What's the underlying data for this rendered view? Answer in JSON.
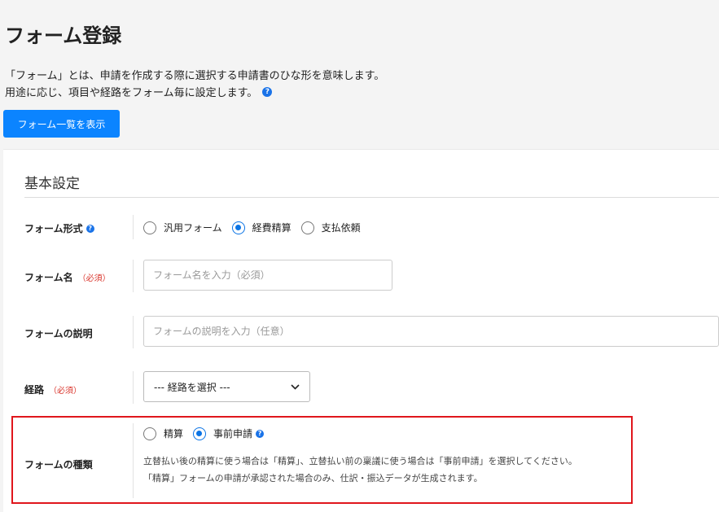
{
  "header": {
    "title": "フォーム登録",
    "desc_line1": "「フォーム」とは、申請を作成する際に選択する申請書のひな形を意味します。",
    "desc_line2": "用途に応じ、項目や経路をフォーム毎に設定します。",
    "help_glyph": "?",
    "list_button": "フォーム一覧を表示"
  },
  "form": {
    "section_title": "基本設定",
    "required_mark": "（必須）",
    "format": {
      "label": "フォーム形式",
      "options": [
        "汎用フォーム",
        "経費精算",
        "支払依頼"
      ],
      "selected": "経費精算"
    },
    "name": {
      "label": "フォーム名",
      "placeholder": "フォーム名を入力（必須）"
    },
    "description": {
      "label": "フォームの説明",
      "placeholder": "フォームの説明を入力（任意）"
    },
    "route": {
      "label": "経路",
      "selected": "--- 経路を選択 ---"
    },
    "kind": {
      "label": "フォームの種類",
      "options": [
        "精算",
        "事前申請"
      ],
      "selected": "事前申請",
      "help_line1": "立替払い後の精算に使う場合は「精算」、立替払い前の稟議に使う場合は「事前申請」を選択してください。",
      "help_line2": "「精算」フォームの申請が承認された場合のみ、仕訳・振込データが生成されます。"
    }
  },
  "colors": {
    "primary": "#0b84ff",
    "radio_checked": "#0b74e5",
    "required": "#d9342b",
    "highlight": "#e0161c"
  }
}
